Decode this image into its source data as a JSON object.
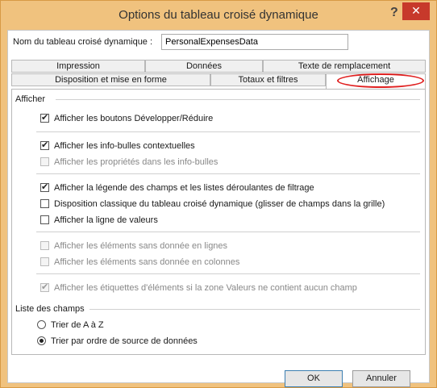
{
  "window": {
    "title": "Options du tableau croisé dynamique",
    "help_label": "?",
    "close_label": "✕"
  },
  "name_field": {
    "label": "Nom du tableau croisé dynamique :",
    "value": "PersonalExpensesData"
  },
  "tabs": {
    "row1": [
      "Impression",
      "Données",
      "Texte de remplacement"
    ],
    "row2": [
      "Disposition et mise en forme",
      "Totaux et filtres",
      "Affichage"
    ],
    "active": "Affichage"
  },
  "afficher": {
    "heading": "Afficher",
    "items": [
      {
        "label": "Afficher les boutons Développer/Réduire",
        "checked": true,
        "enabled": true
      },
      {
        "label": "Afficher les info-bulles contextuelles",
        "checked": true,
        "enabled": true
      },
      {
        "label": "Afficher les propriétés dans les info-bulles",
        "checked": false,
        "enabled": false
      },
      {
        "label": "Afficher la légende des champs et les listes déroulantes de filtrage",
        "checked": true,
        "enabled": true
      },
      {
        "label": "Disposition classique du tableau croisé dynamique (glisser de champs dans la grille)",
        "checked": false,
        "enabled": true
      },
      {
        "label": "Afficher la ligne de valeurs",
        "checked": false,
        "enabled": true
      },
      {
        "label": "Afficher les éléments sans donnée en lignes",
        "checked": false,
        "enabled": false
      },
      {
        "label": "Afficher les éléments sans donnée en colonnes",
        "checked": false,
        "enabled": false
      },
      {
        "label": "Afficher les étiquettes d'éléments si la zone Valeurs ne contient aucun champ",
        "checked": true,
        "enabled": false
      }
    ]
  },
  "liste_champs": {
    "heading": "Liste des champs",
    "options": [
      {
        "label": "Trier de A à Z",
        "selected": false
      },
      {
        "label": "Trier par ordre de source de données",
        "selected": true
      }
    ]
  },
  "buttons": {
    "ok": "OK",
    "cancel": "Annuler"
  },
  "colors": {
    "frame": "#f0c27e",
    "close": "#c7392b",
    "highlight_oval": "#e02020"
  }
}
